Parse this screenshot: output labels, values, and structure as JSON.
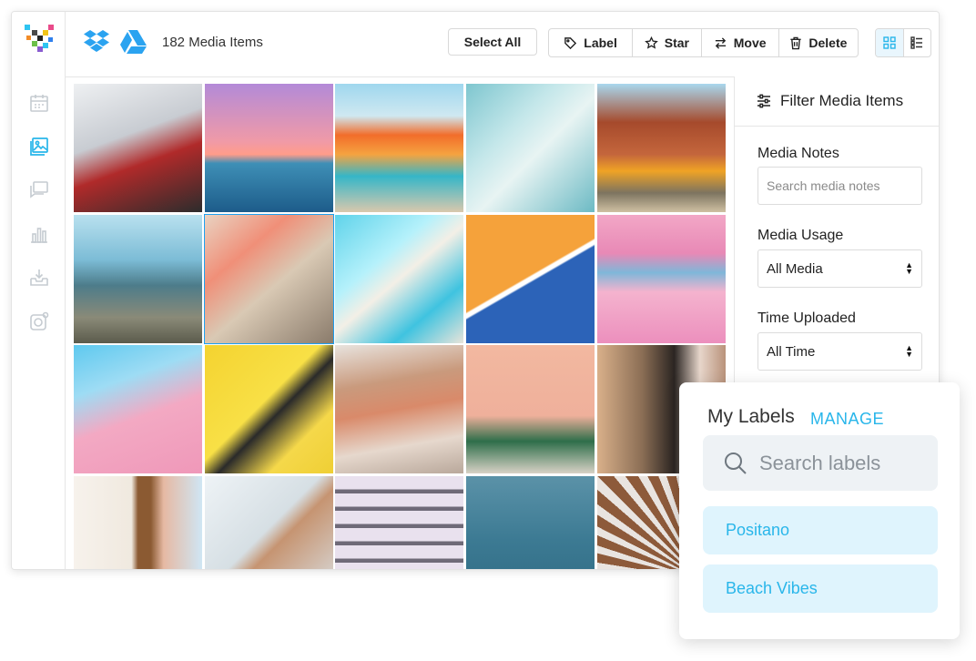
{
  "header": {
    "media_count": "182 Media Items",
    "select_all_label": "Select All",
    "actions": [
      {
        "label": "Label",
        "icon": "tag-icon"
      },
      {
        "label": "Star",
        "icon": "star-icon"
      },
      {
        "label": "Move",
        "icon": "move-arrows-icon"
      },
      {
        "label": "Delete",
        "icon": "trash-icon"
      }
    ],
    "sources": [
      "dropbox-icon",
      "google-drive-icon"
    ],
    "view_modes": [
      "grid-view-icon",
      "list-view-icon"
    ],
    "active_view": "grid-view-icon"
  },
  "sidebar": {
    "items": [
      {
        "icon": "calendar-icon",
        "active": false
      },
      {
        "icon": "media-library-icon",
        "active": true
      },
      {
        "icon": "comments-icon",
        "active": false
      },
      {
        "icon": "analytics-icon",
        "active": false
      },
      {
        "icon": "inbox-download-icon",
        "active": false
      },
      {
        "icon": "instagram-icon",
        "active": false
      }
    ]
  },
  "filter": {
    "title": "Filter Media Items",
    "media_notes_label": "Media Notes",
    "media_notes_placeholder": "Search media notes",
    "media_usage_label": "Media Usage",
    "media_usage_value": "All Media",
    "time_uploaded_label": "Time Uploaded",
    "time_uploaded_value": "All Time"
  },
  "labels_panel": {
    "title": "My Labels",
    "manage_label": "MANAGE",
    "search_placeholder": "Search labels",
    "items": [
      "Positano",
      "Beach Vibes"
    ]
  },
  "colors": {
    "accent": "#29b6ea",
    "chip_bg": "#dff4fd",
    "search_bg": "#eef2f5"
  }
}
